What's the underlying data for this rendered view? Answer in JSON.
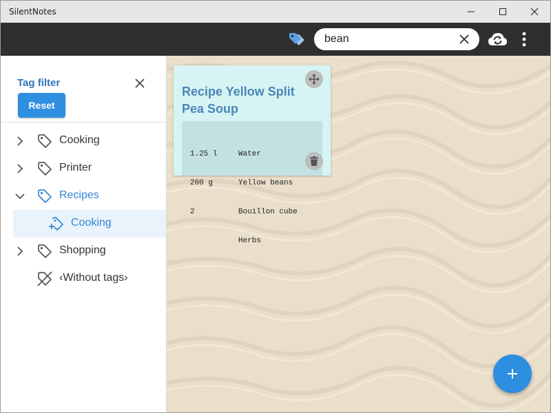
{
  "window": {
    "title": "SilentNotes",
    "controls": [
      "minimize-icon",
      "maximize-icon",
      "close-icon"
    ]
  },
  "toolbar": {
    "tag_filter_icon": "tags-icon",
    "search": {
      "value": "bean",
      "placeholder": ""
    },
    "clear_icon": "close-icon",
    "sync_icon": "cloud-sync-icon",
    "menu_icon": "more-vert-icon"
  },
  "tag_panel": {
    "title": "Tag filter",
    "reset_label": "Reset",
    "tags": [
      {
        "label": "Cooking",
        "expanded": false,
        "icon": "tag-icon"
      },
      {
        "label": "Printer",
        "expanded": false,
        "icon": "tag-icon"
      },
      {
        "label": "Recipes",
        "expanded": true,
        "icon": "tag-icon",
        "children": [
          {
            "label": "Cooking",
            "icon": "tag-add-icon",
            "selected": true
          }
        ]
      },
      {
        "label": "Shopping",
        "expanded": false,
        "icon": "tag-icon"
      },
      {
        "label": "‹Without tags›",
        "icon": "tag-off-icon"
      }
    ]
  },
  "notes": [
    {
      "title": "Recipe Yellow Split Pea Soup",
      "background": "#d6f4f4",
      "table": {
        "quantities": [
          "1.25 l",
          "200 g",
          "2",
          ""
        ],
        "items": [
          "Water",
          "Yellow beans",
          "Bouillon cube",
          "Herbs"
        ]
      }
    }
  ],
  "fab_icon": "plus-icon",
  "colors": {
    "accent": "#2e8ee0",
    "toolbar": "#2f2f2f",
    "tag_active": "#2f86d6",
    "note_title": "#4a86b8"
  }
}
